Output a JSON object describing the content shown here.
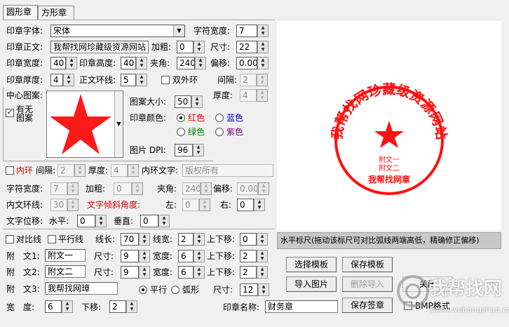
{
  "tabs": [
    "圆形章",
    "方形章"
  ],
  "font": {
    "label": "印章字体:",
    "value": "宋体"
  },
  "char_width": {
    "label": "字符宽度:",
    "value": "7"
  },
  "main_text": {
    "label": "印章正文:",
    "value": "我帮找网珍藏级资源网站"
  },
  "bold": {
    "label": "加粗:",
    "value": "0"
  },
  "size": {
    "label": "尺寸:",
    "value": "22"
  },
  "stamp_width": {
    "label": "印章宽度:",
    "value": "40"
  },
  "stamp_height": {
    "label": "印章高度:",
    "value": "40"
  },
  "angle": {
    "label": "夹角:",
    "value": "240"
  },
  "offset": {
    "label": "偏移:",
    "value": "0.000"
  },
  "thickness": {
    "label": "印章厚度:",
    "value": "4"
  },
  "text_ring": {
    "label": "正文环线:",
    "value": "5"
  },
  "double_ring": {
    "label": "双外环"
  },
  "spacing": {
    "label": "间隔:",
    "value": "2"
  },
  "ring_thickness": {
    "label": "厚度:",
    "value": "4"
  },
  "center_image": {
    "label": "中心图案:",
    "has_label": "有无\n图案",
    "size_label": "图案大小:",
    "size_value": "50"
  },
  "color": {
    "label": "印章颜色:",
    "options": [
      "红色",
      "蓝色",
      "绿色",
      "紫色"
    ]
  },
  "dpi": {
    "label": "图片 DPI:",
    "value": "96"
  },
  "inner_ring": {
    "label": "内环",
    "spacing_label": "间隔:",
    "spacing_value": "2",
    "thickness_label": "厚度:",
    "thickness_value": "4",
    "text_label": "内环文字:",
    "text_value": "版权所有"
  },
  "inner": {
    "char_width_label": "字符宽度:",
    "char_width_value": "7",
    "bold_label": "加粗:",
    "bold_value": "0",
    "angle_label": "夹角:",
    "angle_value": "240",
    "offset_label": "偏移:",
    "offset_value": "0.000",
    "ring_label": "内文环线:",
    "ring_value": "30",
    "tilt_label": "文字倾斜角度:",
    "left_label": "左:",
    "left_value": "0",
    "right_label": "右:",
    "right_value": "0",
    "shift_label": "文字位移:",
    "h_label": "水平:",
    "h_value": "0",
    "v_label": "垂直:",
    "v_value": "0"
  },
  "compare": {
    "label": "对比线",
    "parallel_label": "平行线",
    "len_label": "线长:",
    "len_value": "70",
    "width_label": "线宽:",
    "width_value": "2",
    "shift_label": "上下移:",
    "shift_value": "0"
  },
  "sub1": {
    "label": "附　文1:",
    "text": "附文一",
    "size_label": "尺寸:",
    "size_value": "9",
    "width_label": "宽度:",
    "width_value": "6",
    "shift_label": "上下移:",
    "shift_value": "2"
  },
  "sub2": {
    "label": "附　文2:",
    "text": "附文二",
    "size_label": "尺寸:",
    "size_value": "9",
    "width_label": "宽度:",
    "width_value": "6",
    "shift_label": "上下移:",
    "shift_value": "2"
  },
  "sub3": {
    "label": "附　文3:",
    "text": "我帮找网璋",
    "parallel": "平行",
    "arc": "弧形",
    "size_label": "尺寸:",
    "size_value": "12"
  },
  "bottom": {
    "width_label": "宽　度:",
    "width_value": "6",
    "down_label": "下移:",
    "down_value": "2",
    "name_label": "印章名称:",
    "name_value": "财务章"
  },
  "ruler": {
    "text": "水平标尺(拖动该标尺可对比弧线两端高低，精确修正偏移)"
  },
  "buttons": {
    "select_template": "选择模板",
    "save_template": "保存模板",
    "import_image": "导入图片",
    "delete_import": "删除导入",
    "close": "关闭",
    "save_stamp": "保存签章",
    "bmp": "BMP格式"
  },
  "preview": {
    "ring_text": "我帮找网珍藏级资源网站",
    "sub1": "附文一",
    "sub2": "附文二",
    "sub3": "我帮找网章"
  },
  "watermark": {
    "cn": "我帮找网",
    "url": "www.wobangzhao.com"
  },
  "colors": {
    "stamp": "#ff1010",
    "star": "#ff1a1a",
    "ruler_bg": "#c8c8c8"
  }
}
